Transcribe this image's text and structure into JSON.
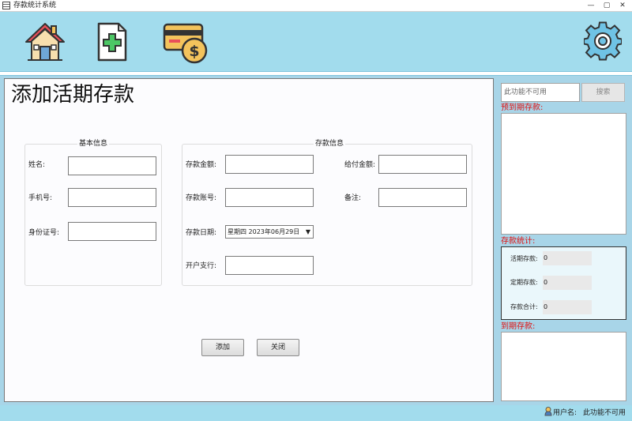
{
  "window": {
    "title": "存款统计系统",
    "minimize": "—",
    "maximize": "▢",
    "close": "✕"
  },
  "toolbar": {
    "home_icon": "home-icon",
    "add_doc_icon": "add-document-icon",
    "card_icon": "credit-card-dollar-icon",
    "settings_icon": "gear-icon"
  },
  "page": {
    "title": "添加活期存款"
  },
  "basic_group": {
    "title": "基本信息",
    "name_label": "姓名:",
    "name_value": "",
    "phone_label": "手机号:",
    "phone_value": "",
    "id_label": "身份证号:",
    "id_value": ""
  },
  "deposit_group": {
    "title": "存款信息",
    "amount_label": "存款金额:",
    "amount_value": "",
    "account_label": "存款账号:",
    "account_value": "",
    "date_label": "存款日期:",
    "date_value": "星期四  2023年06月29日",
    "branch_label": "开户支行:",
    "branch_value": "",
    "pay_label": "给付金额:",
    "pay_value": "",
    "note_label": "备注:",
    "note_value": ""
  },
  "actions": {
    "add_label": "添加",
    "close_label": "关闭"
  },
  "sidebar": {
    "search_placeholder": "此功能不可用",
    "search_button": "搜索",
    "due_soon_title": "预到期存款:",
    "stats_title": "存款统计:",
    "current_label": "活期存款:",
    "current_value": "0",
    "fixed_label": "定期存款:",
    "fixed_value": "0",
    "total_label": "存款合计:",
    "total_value": "0",
    "due_title": "到期存款:"
  },
  "statusbar": {
    "user_label": "用户名:",
    "user_value": "此功能不可用"
  },
  "colors": {
    "toolbar_bg": "#a2dced",
    "accent_red": "#e01010",
    "form_bg": "#fcfcfe"
  }
}
